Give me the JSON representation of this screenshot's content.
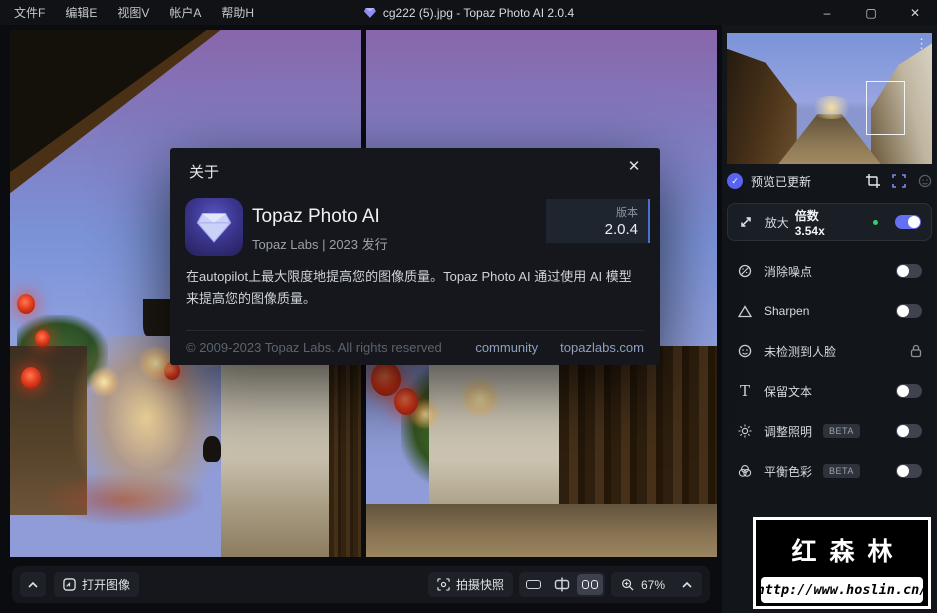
{
  "titlebar": {
    "title": "cg222 (5).jpg - Topaz Photo AI 2.0.4",
    "menu": [
      "文件F",
      "编辑E",
      "视图V",
      "帐户A",
      "帮助H"
    ],
    "controls": {
      "minimize": "–",
      "maximize": "▢",
      "close": "✕"
    }
  },
  "dialog": {
    "title": "关于",
    "close": "✕",
    "app_name": "Topaz Photo AI",
    "publisher": "Topaz Labs | 2023 发行",
    "version_label": "版本",
    "version": "2.0.4",
    "description": "在autopilot上最大限度地提高您的图像质量。Topaz Photo AI 通过使用 AI 模型来提高您的图像质量。",
    "copyright": "© 2009-2023 Topaz Labs. All rights reserved",
    "links": [
      "community",
      "topazlabs.com"
    ]
  },
  "sidebar": {
    "menu_icon": "⋮",
    "preview_status": "预览已更新",
    "tools": [
      {
        "label": "放大",
        "value": "倍数 3.54x",
        "state": "on"
      },
      {
        "label": "消除噪点",
        "state": "off"
      },
      {
        "label": "Sharpen",
        "state": "off"
      },
      {
        "label": "未检测到人脸",
        "state": "locked"
      },
      {
        "label": "保留文本",
        "state": "off"
      },
      {
        "label": "调整照明",
        "badge": "BETA",
        "state": "off"
      },
      {
        "label": "平衡色彩",
        "badge": "BETA",
        "state": "off"
      }
    ]
  },
  "bottom_bar": {
    "open_image": "打开图像",
    "snapshot": "拍摄快照",
    "zoom": "67%"
  },
  "watermark": {
    "title": "红森林",
    "url": "http://www.hoslin.cn/"
  },
  "colors": {
    "accent": "#6470f2",
    "toggle_off": "#3e434e",
    "version_border": "#4e6fd4",
    "success_dot": "#2fd06a",
    "sky": "#7b93d8"
  }
}
